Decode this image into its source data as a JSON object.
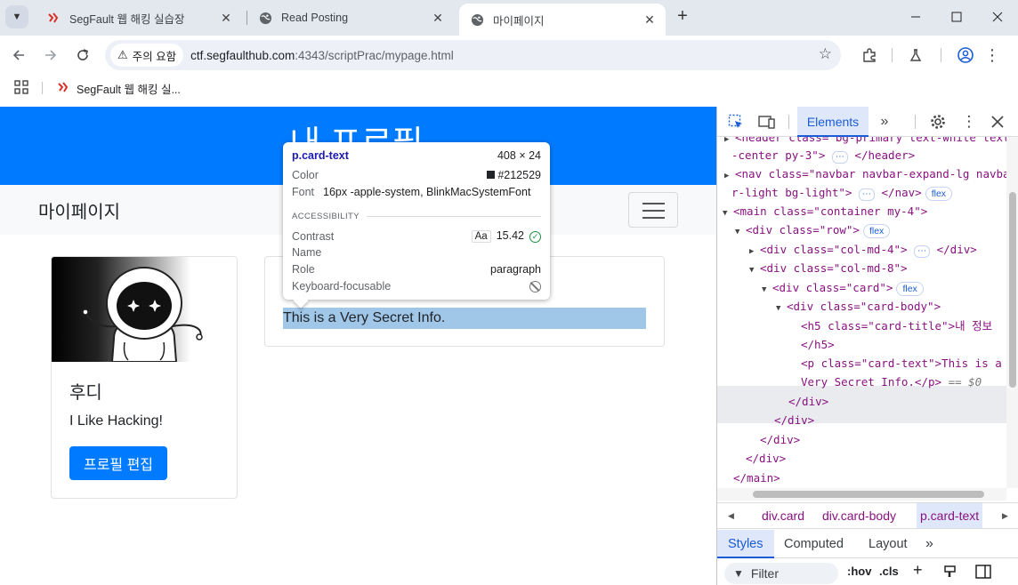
{
  "browser": {
    "tabs": [
      {
        "title": "SegFault 웹 해킹 실습장",
        "active": false
      },
      {
        "title": "Read Posting",
        "active": false
      },
      {
        "title": "마이페이지",
        "active": true
      }
    ],
    "security_chip": "주의 요함",
    "url_host": "ctf.segfaulthub.com",
    "url_path": ":4343/scriptPrac/mypage.html",
    "bookmark": "SegFault 웹 해킹 실..."
  },
  "page": {
    "header_title": "내 프로필",
    "navbar_brand": "마이페이지",
    "profile": {
      "name": "후디",
      "bio": "I Like Hacking!",
      "edit_button": "프로필 편집"
    },
    "info_text": "This is a Very Secret Info."
  },
  "tooltip": {
    "selector": "p.card-text",
    "size": "408 × 24",
    "color_label": "Color",
    "color_value": "#212529",
    "font_label": "Font",
    "font_value": "16px -apple-system, BlinkMacSystemFont",
    "section": "ACCESSIBILITY",
    "contrast_label": "Contrast",
    "contrast_aa": "Aa",
    "contrast_value": "15.42",
    "name_label": "Name",
    "role_label": "Role",
    "role_value": "paragraph",
    "keyboard_label": "Keyboard-focusable"
  },
  "devtools": {
    "active_tab": "Elements",
    "dom_lines": [
      "<header class=\"bg-primary text-white text",
      "-center py-3\">",
      "<nav class=\"navbar navbar-expand-lg navba",
      "r-light bg-light\">",
      "<main class=\"container my-4\">",
      "<div class=\"row\">",
      "<div class=\"col-md-4\">",
      "<div class=\"col-md-8\">",
      "<div class=\"card\">",
      "<div class=\"card-body\">",
      "<h5 class=\"card-title\">내 정보",
      "</h5>",
      "<p class=\"card-text\">This is a",
      "Very Secret Info.</p>",
      "</div>",
      "</div>",
      "</div>",
      "</div>",
      "</main>"
    ],
    "badge_flex": "flex",
    "badge_dots": "⋯",
    "dollar_ref": "== $0",
    "breadcrumbs": [
      "div.card",
      "div.card-body",
      "p.card-text"
    ],
    "style_tabs": [
      "Styles",
      "Computed",
      "Layout"
    ],
    "filter_placeholder": "Filter",
    "hov": ":hov",
    "cls": ".cls"
  }
}
